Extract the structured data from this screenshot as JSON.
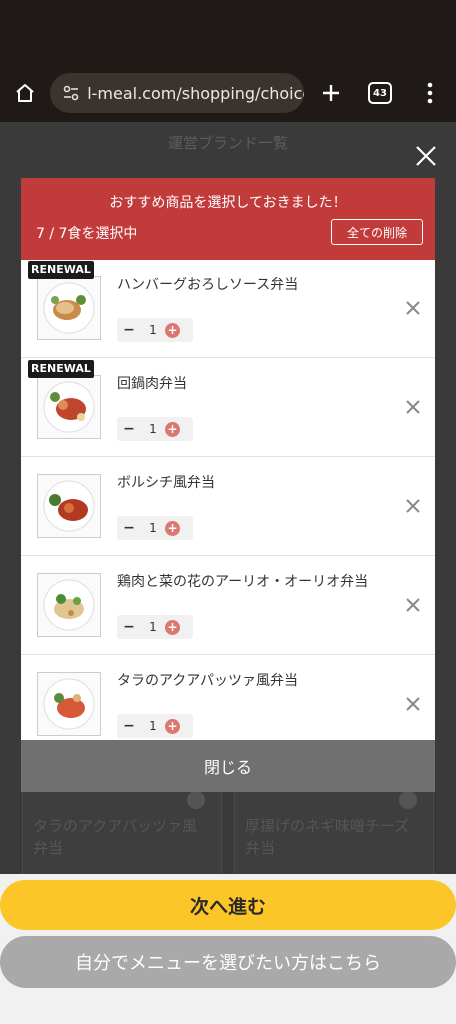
{
  "browser": {
    "url": "l-meal.com/shopping/choice",
    "tab_count": "43"
  },
  "page": {
    "brand_header": "運営ブランド一覧"
  },
  "background_cards": [
    {
      "name": "タラのアクアパッツァ風弁当"
    },
    {
      "name": "厚揚げのネギ味噌チーズ弁当"
    }
  ],
  "modal": {
    "title": "おすすめ商品を選択しておきました！",
    "count": "7 / 7食を選択中",
    "delete_all": "全ての削除",
    "close": "閉じる",
    "items": [
      {
        "badge": "RENEWAL",
        "name": "ハンバーグおろしソース弁当",
        "qty": "1"
      },
      {
        "badge": "RENEWAL",
        "name": "回鍋肉弁当",
        "qty": "1"
      },
      {
        "badge": "",
        "name": "ボルシチ風弁当",
        "qty": "1"
      },
      {
        "badge": "",
        "name": "鶏肉と菜の花のアーリオ・オーリオ弁当",
        "qty": "1"
      },
      {
        "badge": "",
        "name": "タラのアクアパッツァ風弁当",
        "qty": "1"
      }
    ]
  },
  "bottom": {
    "next": "次へ進む",
    "self_select": "自分でメニューを選びたい方はこちら"
  },
  "colors": {
    "header_red": "#c23b3b",
    "next_yellow": "#fcc628",
    "plus_pink": "#d97870"
  }
}
